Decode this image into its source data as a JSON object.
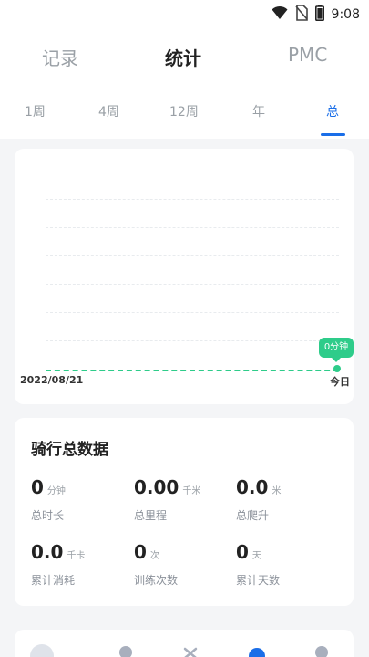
{
  "status_bar": {
    "time": "9:08",
    "icons": [
      "wifi-icon",
      "no-sim-icon",
      "battery-icon"
    ]
  },
  "main_tabs": [
    {
      "label": "记录",
      "active": false
    },
    {
      "label": "统计",
      "active": true
    },
    {
      "label": "PMC",
      "active": false
    }
  ],
  "sub_tabs": [
    {
      "label": "1周",
      "active": false
    },
    {
      "label": "4周",
      "active": false
    },
    {
      "label": "12周",
      "active": false
    },
    {
      "label": "年",
      "active": false
    },
    {
      "label": "总",
      "active": true
    }
  ],
  "chart": {
    "start_label": "2022/08/21",
    "end_label": "今日",
    "tooltip": "0分钟"
  },
  "chart_data": {
    "type": "line",
    "x": [
      "2022/08/21",
      "今日"
    ],
    "values": [
      0,
      0
    ],
    "tooltip_value": "0分钟",
    "grid": true
  },
  "stats": {
    "title": "骑行总数据",
    "items": [
      {
        "value": "0",
        "unit": "分钟",
        "label": "总时长"
      },
      {
        "value": "0.00",
        "unit": "千米",
        "label": "总里程"
      },
      {
        "value": "0.0",
        "unit": "米",
        "label": "总爬升"
      },
      {
        "value": "0.0",
        "unit": "千卡",
        "label": "累计消耗"
      },
      {
        "value": "0",
        "unit": "次",
        "label": "训练次数"
      },
      {
        "value": "0",
        "unit": "天",
        "label": "累计天数"
      }
    ]
  },
  "colors": {
    "accent": "#1a6ee8",
    "chart_green": "#2ecc8a",
    "background": "#f4f5f7"
  }
}
